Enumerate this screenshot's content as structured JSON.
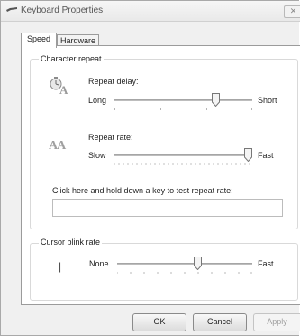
{
  "window": {
    "title": "Keyboard Properties",
    "close_glyph": "✕"
  },
  "tabs": [
    {
      "label": "Speed",
      "selected": true
    },
    {
      "label": "Hardware",
      "selected": false
    }
  ],
  "character_repeat": {
    "group_label": "Character repeat",
    "repeat_delay": {
      "label": "Repeat delay:",
      "min_label": "Long",
      "max_label": "Short",
      "level": 0.75,
      "icon": "repeat-delay-icon"
    },
    "repeat_rate": {
      "label": "Repeat rate:",
      "min_label": "Slow",
      "max_label": "Fast",
      "level": 1.0,
      "icon": "repeat-rate-icon",
      "icon_text": "AA"
    },
    "test_label": "Click here and hold down a key to test repeat rate:",
    "test_value": ""
  },
  "cursor_blink": {
    "group_label": "Cursor blink rate",
    "min_label": "None",
    "max_label": "Fast",
    "level": 0.6,
    "cursor_glyph": "|"
  },
  "buttons": {
    "ok": "OK",
    "cancel": "Cancel",
    "apply": "Apply"
  }
}
